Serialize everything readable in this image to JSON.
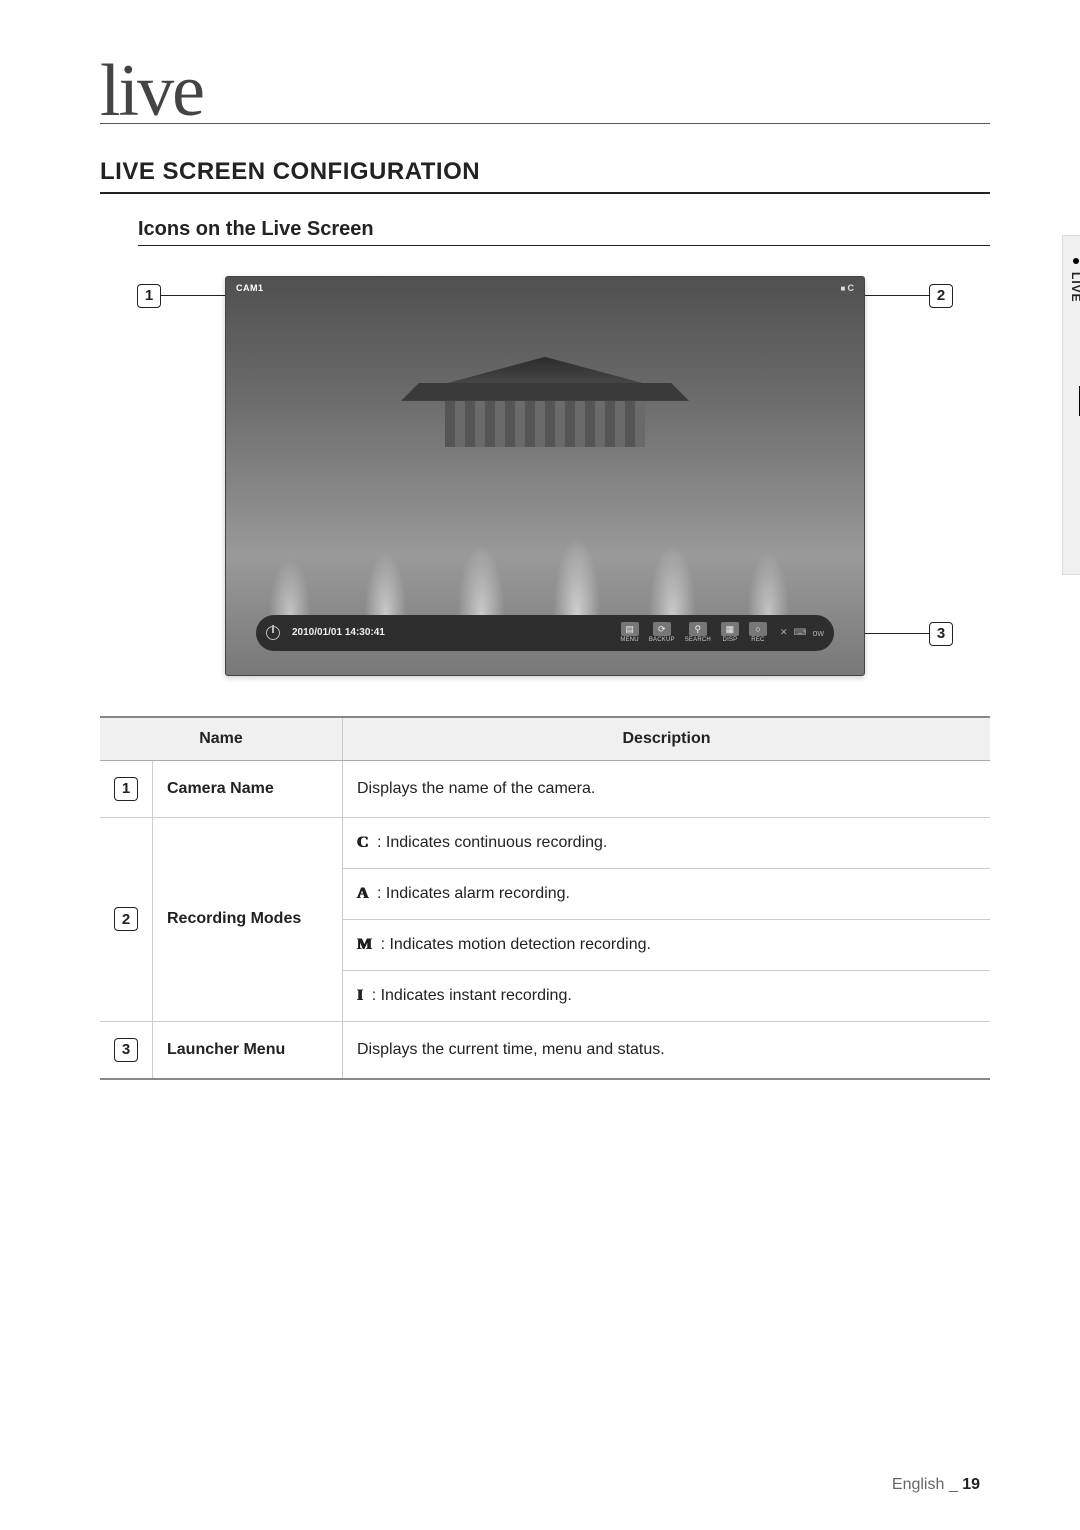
{
  "chapter_title": "live",
  "section_heading": "LIVE SCREEN CONFIGURATION",
  "subsection_heading": "Icons on the Live Screen",
  "side_tab": "LIVE",
  "screenshot": {
    "cam_label": "CAM1",
    "rec_indicator": "C",
    "datetime": "2010/01/01 14:30:41",
    "launcher_buttons": [
      {
        "icon": "▤",
        "label": "MENU"
      },
      {
        "icon": "⟳",
        "label": "BACKUP"
      },
      {
        "icon": "⚲",
        "label": "SEARCH"
      },
      {
        "icon": "▦",
        "label": "DISP"
      },
      {
        "icon": "○",
        "label": "REC"
      }
    ],
    "launcher_extra": "ow"
  },
  "callouts": {
    "c1": "1",
    "c2": "2",
    "c3": "3"
  },
  "table": {
    "headers": {
      "name": "Name",
      "description": "Description"
    },
    "rows": [
      {
        "num": "1",
        "name": "Camera Name",
        "desc_lines": [
          {
            "glyph": "",
            "text": "Displays the name of the camera."
          }
        ]
      },
      {
        "num": "2",
        "name": "Recording Modes",
        "desc_lines": [
          {
            "glyph": "C",
            "text": ": Indicates continuous recording."
          },
          {
            "glyph": "A",
            "text": ": Indicates alarm recording."
          },
          {
            "glyph": "M",
            "text": ": Indicates motion detection recording."
          },
          {
            "glyph": "I",
            "text": ": Indicates instant recording."
          }
        ]
      },
      {
        "num": "3",
        "name": "Launcher Menu",
        "desc_lines": [
          {
            "glyph": "",
            "text": "Displays the current time, menu and status."
          }
        ]
      }
    ]
  },
  "footer": {
    "lang": "English",
    "sep": "_",
    "page": "19"
  }
}
